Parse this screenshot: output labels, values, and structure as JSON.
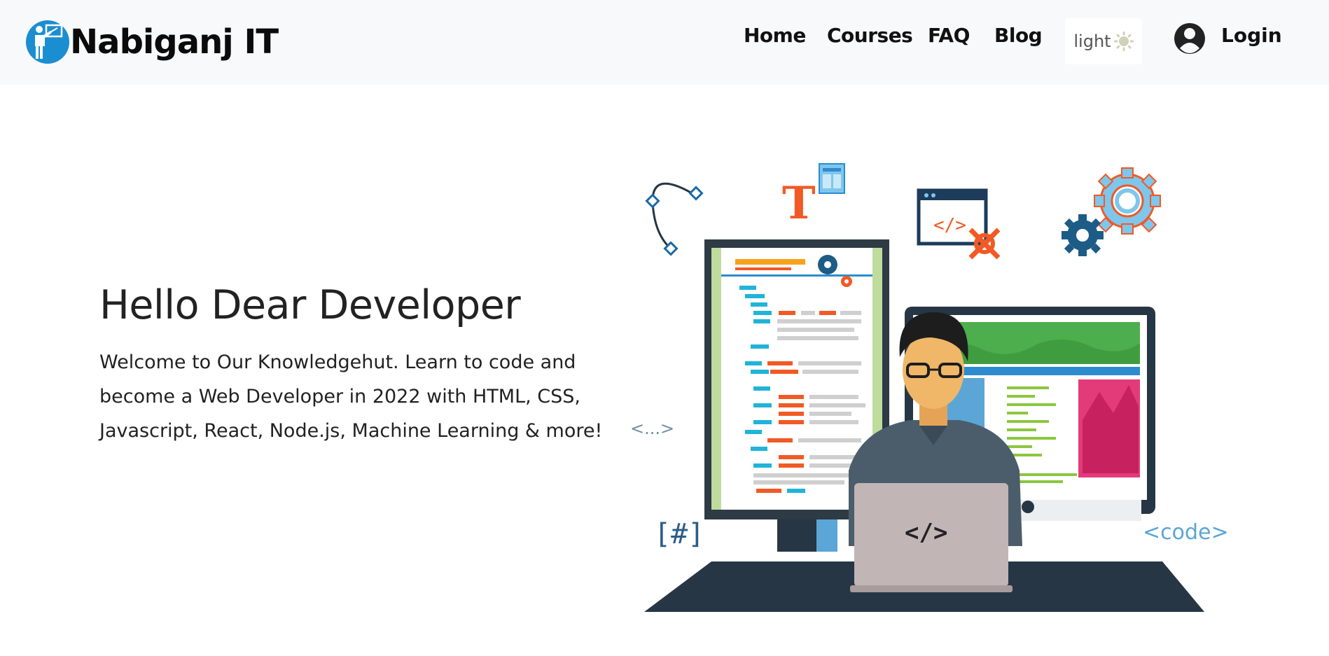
{
  "brand": {
    "name": "Nabiganj IT",
    "logo_icon": "teacher-presentation-icon",
    "logo_color": "#1b8ed1"
  },
  "nav": {
    "items": [
      {
        "label": "Home"
      },
      {
        "label": "Courses"
      },
      {
        "label": "FAQ"
      },
      {
        "label": "Blog"
      }
    ],
    "theme_label": "light",
    "theme_icon": "sun-icon",
    "login_label": "Login",
    "user_icon": "user-circle-icon"
  },
  "hero": {
    "title": "Hello Dear Developer",
    "text": "Welcome to Our Knowledgehut. Learn to code and become a Web Developer in 2022 with HTML, CSS, Javascript, React, Node.js, Machine Learning & more!"
  },
  "illustration": {
    "code_tag": "</>",
    "hash_tag": "[#]",
    "code_label": "<code>",
    "ellipsis_tag": "<...>",
    "title_letter": "T"
  },
  "colors": {
    "accent_blue": "#1b8ed1",
    "orange": "#f15a24",
    "dark_desk": "#263645",
    "navbar_bg": "#f8f9fa"
  }
}
